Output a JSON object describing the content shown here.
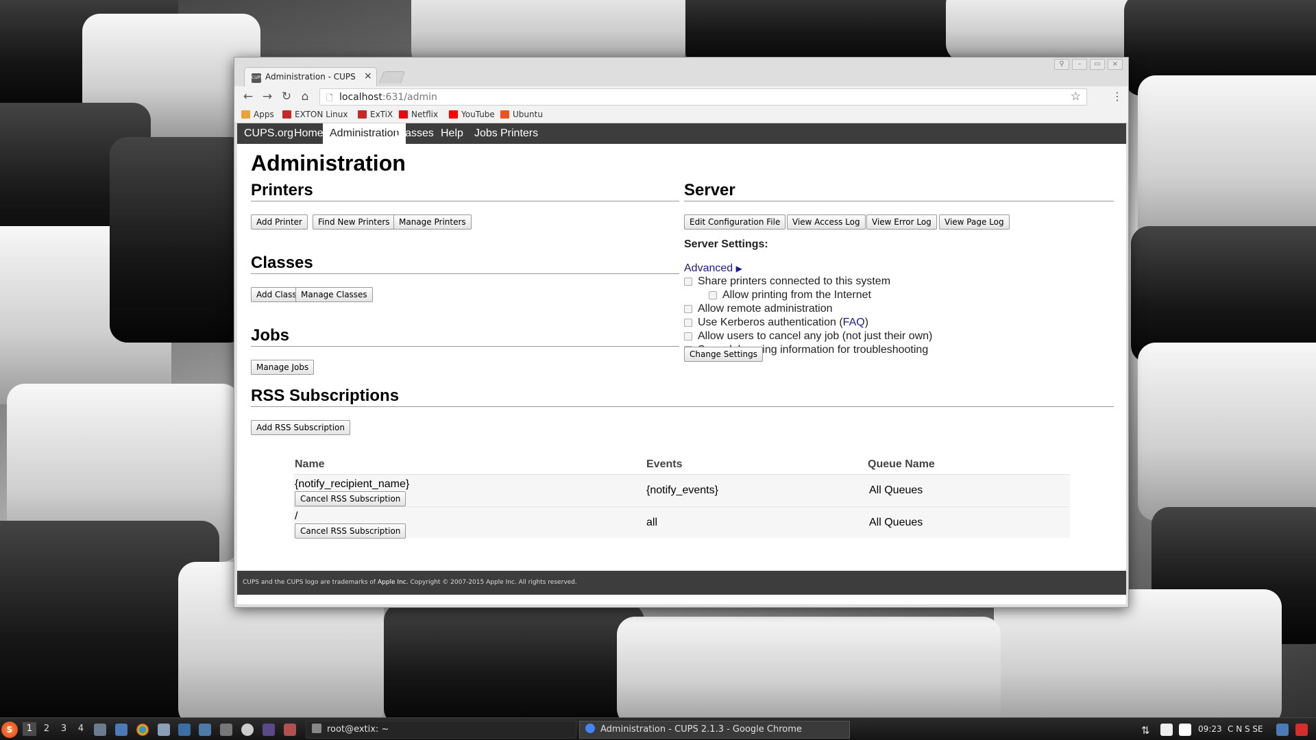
{
  "browser": {
    "tab_title": "Administration - CUPS",
    "tab_favicon_text": "CUPS",
    "url_host": "localhost",
    "url_path": ":631/admin",
    "bookmarks": [
      {
        "label": "Apps",
        "color": "#e8a33a"
      },
      {
        "label": "EXTON Linux",
        "color": "#c62828"
      },
      {
        "label": "ExTiX",
        "color": "#c62828"
      },
      {
        "label": "Netflix",
        "color": "#e50914"
      },
      {
        "label": "YouTube",
        "color": "#ff0000"
      },
      {
        "label": "Ubuntu",
        "color": "#e95420"
      }
    ]
  },
  "cups": {
    "nav": [
      "CUPS.org",
      "Home",
      "Administration",
      "Classes",
      "Help",
      "Jobs",
      "Printers"
    ],
    "nav_active": "Administration",
    "page_title": "Administration",
    "printers": {
      "heading": "Printers",
      "buttons": [
        "Add Printer",
        "Find New Printers",
        "Manage Printers"
      ]
    },
    "classes": {
      "heading": "Classes",
      "buttons": [
        "Add Class",
        "Manage Classes"
      ]
    },
    "jobs": {
      "heading": "Jobs",
      "buttons": [
        "Manage Jobs"
      ]
    },
    "server": {
      "heading": "Server",
      "buttons": [
        "Edit Configuration File",
        "View Access Log",
        "View Error Log",
        "View Page Log"
      ],
      "settings_label": "Server Settings:",
      "advanced_link": "Advanced",
      "advanced_arrow": "▶",
      "options": [
        {
          "label": "Share printers connected to this system",
          "checked": false,
          "indent": 0
        },
        {
          "label": "Allow printing from the Internet",
          "checked": false,
          "indent": 1
        },
        {
          "label": "Allow remote administration",
          "checked": false,
          "indent": 0
        },
        {
          "label": "Use Kerberos authentication (",
          "link": "FAQ",
          "suffix": ")",
          "checked": false,
          "indent": 0
        },
        {
          "label": "Allow users to cancel any job (not just their own)",
          "checked": false,
          "indent": 0
        },
        {
          "label": "Save debugging information for troubleshooting",
          "checked": false,
          "indent": 0
        }
      ],
      "change_button": "Change Settings"
    },
    "rss": {
      "heading": "RSS Subscriptions",
      "add_button": "Add RSS Subscription",
      "columns": [
        "Name",
        "Events",
        "Queue Name"
      ],
      "rows": [
        {
          "name": "{notify_recipient_name}",
          "events": "{notify_events}",
          "queue": "All Queues",
          "cancel": "Cancel RSS Subscription"
        },
        {
          "name": "/",
          "events": "all",
          "queue": "All Queues",
          "cancel": "Cancel RSS Subscription"
        }
      ]
    },
    "footer": {
      "prefix": "CUPS and the CUPS logo are trademarks of ",
      "company": "Apple Inc.",
      "suffix": " Copyright © 2007-2015 Apple Inc. All rights reserved."
    }
  },
  "taskbar": {
    "workspaces": [
      "1",
      "2",
      "3",
      "4"
    ],
    "active_workspace": "1",
    "tasks": [
      {
        "label": "root@extix: ~",
        "active": false
      },
      {
        "label": "Administration - CUPS 2.1.3 - Google Chrome",
        "active": true
      }
    ],
    "clock": "09:23",
    "locale": "C N S SE"
  }
}
